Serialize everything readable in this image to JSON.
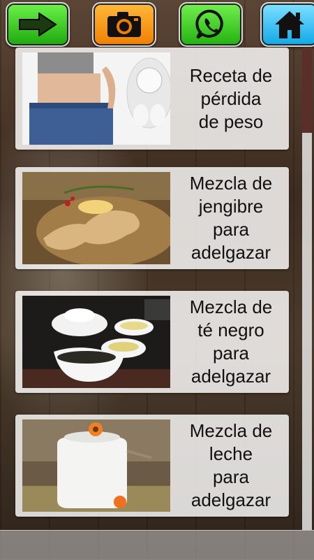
{
  "toolbar": {
    "buttons": [
      {
        "icon": "arrow-right-icon"
      },
      {
        "icon": "camera-icon"
      },
      {
        "icon": "whatsapp-icon"
      },
      {
        "icon": "home-icon"
      }
    ]
  },
  "recipes": [
    {
      "title": "Receta de\npérdida\nde peso",
      "image": "waist-scale-image"
    },
    {
      "title": "Mezcla de\njengibre\npara\nadelgazar",
      "image": "ginger-image"
    },
    {
      "title": "Mezcla de\nté negro\npara\nadelgazar",
      "image": "black-tea-image"
    },
    {
      "title": "Mezcla de\nleche\npara\nadelgazar",
      "image": "milk-jug-image"
    }
  ],
  "colors": {
    "scroll_thumb": "#5a2f2a",
    "arrow_button": "#1ea80e",
    "camera_button": "#f07f00",
    "home_button": "#10a7e8"
  }
}
